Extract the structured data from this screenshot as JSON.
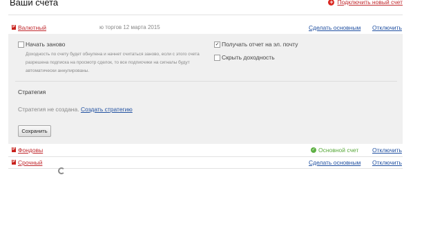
{
  "header": {
    "title": "Ваши счета",
    "add_account_label": "Подключить новый счет"
  },
  "accounts": [
    {
      "name": "Валютный",
      "date_text": "ю торгов 12 марта 2015",
      "make_main_label": "Сделать основным",
      "disconnect_label": "Отключить"
    },
    {
      "name": "Фондовы",
      "main_account_label": "Основной счет",
      "disconnect_label": "Отключить"
    },
    {
      "name": "Срочный",
      "make_main_label": "Сделать основным",
      "disconnect_label": "Отключить"
    }
  ],
  "settings": {
    "restart_label": "Начать заново",
    "restart_checked": false,
    "restart_note": "Доходность по счету будет обнулена и начнет считаться заново, если с этого счета разрешена подписка на просмотр сделок, то все подписчики на сигналы будут автоматически аннулированы.",
    "email_report_label": "Получать отчет на эл. почту",
    "email_report_checked": true,
    "hide_profit_label": "Скрыть доходность",
    "hide_profit_checked": false
  },
  "strategy": {
    "heading": "Стратегия",
    "status_text": "Стратегия не создана.",
    "create_link": "Создать стратегию",
    "save_button": "Сохранить"
  },
  "icons": {
    "badge_letter": "P",
    "checkmark": "✓"
  },
  "colors": {
    "accent_red": "#c0282d",
    "link_blue": "#1f4fa0",
    "success_green": "#58a83a",
    "panel_gray": "#f0f0f0"
  }
}
